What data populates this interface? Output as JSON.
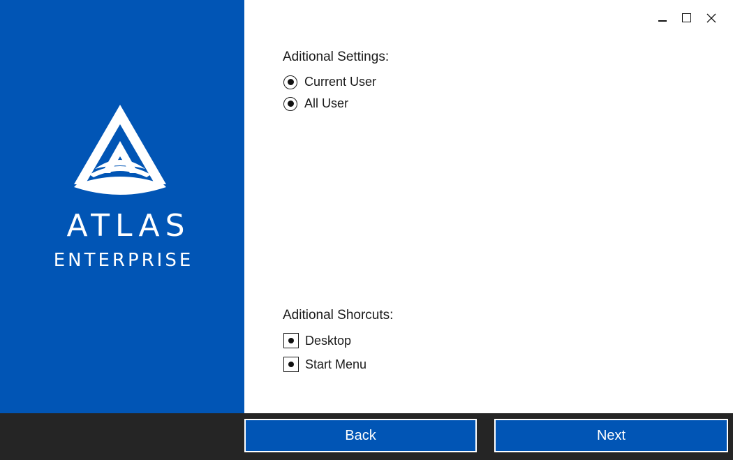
{
  "brand": {
    "name": "ATLAS",
    "subtitle": "ENTERPRISE",
    "accent_color": "#0155b5",
    "logo_icon": "atlas-logo-icon"
  },
  "window_controls": {
    "minimize_icon": "minimize-icon",
    "maximize_icon": "maximize-icon",
    "close_icon": "close-icon"
  },
  "settings": {
    "title": "Aditional Settings:",
    "options": [
      {
        "label": "Current User",
        "selected": true
      },
      {
        "label": "All User",
        "selected": true
      }
    ]
  },
  "shortcuts": {
    "title": "Aditional Shorcuts:",
    "options": [
      {
        "label": "Desktop",
        "checked": true
      },
      {
        "label": "Start Menu",
        "checked": true
      }
    ]
  },
  "footer": {
    "back_label": "Back",
    "next_label": "Next",
    "background_color": "#252525"
  }
}
